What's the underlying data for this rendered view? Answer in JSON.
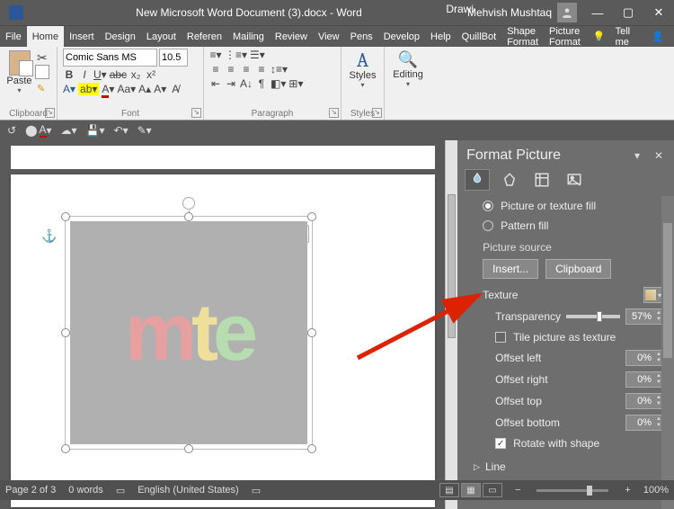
{
  "title": "New Microsoft Word Document (3).docx - Word",
  "contextual_tab": "Drawi",
  "user_name": "Mehvish Mushtaq",
  "menu": [
    "File",
    "Home",
    "Insert",
    "Design",
    "Layout",
    "Referen",
    "Mailing",
    "Review",
    "View",
    "Pens",
    "Develop",
    "Help",
    "QuillBot",
    "Shape Format",
    "Picture Format"
  ],
  "active_menu": "Home",
  "tell_me": "Tell me",
  "share": "Share",
  "font": {
    "name": "Comic Sans MS",
    "size": "10.5"
  },
  "groups": {
    "clipboard": "Clipboard",
    "font": "Font",
    "paragraph": "Paragraph",
    "styles": "Styles",
    "editing": "Editing"
  },
  "paste_label": "Paste",
  "styles_label": "Styles",
  "editing_label": "Editing",
  "pane": {
    "title": "Format Picture",
    "fill_pictex": "Picture or texture fill",
    "fill_pattern": "Pattern fill",
    "pic_src": "Picture source",
    "insert": "Insert...",
    "clipboard": "Clipboard",
    "texture": "Texture",
    "transparency": "Transparency",
    "transparency_val": "57%",
    "tile": "Tile picture as texture",
    "offset_left": "Offset left",
    "offset_right": "Offset right",
    "offset_top": "Offset top",
    "offset_bottom": "Offset bottom",
    "offset_val": "0%",
    "rotate": "Rotate with shape",
    "line": "Line"
  },
  "status": {
    "page": "Page 2 of 3",
    "words": "0 words",
    "lang": "English (United States)",
    "zoom": "100%"
  },
  "mte": {
    "m": "m",
    "t": "t",
    "e": "e"
  }
}
